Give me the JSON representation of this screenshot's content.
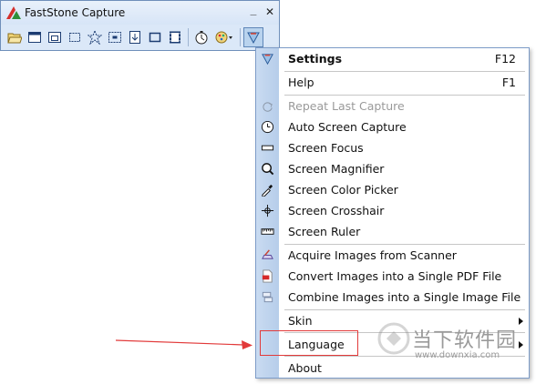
{
  "window": {
    "title": "FastStone Capture",
    "min_label": "_",
    "close_label": "✕"
  },
  "toolbar": {
    "tools": [
      {
        "name": "open-icon"
      },
      {
        "name": "capture-window-icon"
      },
      {
        "name": "capture-object-icon"
      },
      {
        "name": "capture-rectangle-icon"
      },
      {
        "name": "capture-freehand-icon"
      },
      {
        "name": "capture-fullscreen-icon"
      },
      {
        "name": "capture-scrolling-icon"
      },
      {
        "name": "capture-fixed-region-icon"
      },
      {
        "name": "video-recorder-icon"
      },
      {
        "name": "delay-timer-icon"
      },
      {
        "name": "output-destination-icon"
      },
      {
        "name": "settings-menu-icon"
      }
    ]
  },
  "menu": {
    "items": [
      {
        "label": "Settings",
        "key": "F12",
        "bold": true,
        "icon": "settings-icon"
      },
      {
        "label": "Help",
        "key": "F1",
        "icon": "help-icon"
      },
      {
        "label": "Repeat Last Capture",
        "disabled": true,
        "icon": "repeat-icon"
      },
      {
        "label": "Auto Screen Capture",
        "icon": "clock-icon"
      },
      {
        "label": "Screen Focus",
        "icon": "focus-rect-icon"
      },
      {
        "label": "Screen Magnifier",
        "icon": "magnifier-icon"
      },
      {
        "label": "Screen Color Picker",
        "icon": "eyedropper-icon"
      },
      {
        "label": "Screen Crosshair",
        "icon": "crosshair-icon"
      },
      {
        "label": "Screen Ruler",
        "icon": "ruler-icon"
      },
      {
        "label": "Acquire Images from Scanner",
        "icon": "scanner-icon"
      },
      {
        "label": "Convert Images into a Single PDF File",
        "icon": "pdf-icon"
      },
      {
        "label": "Combine Images into a Single Image File",
        "icon": "combine-images-icon"
      },
      {
        "label": "Skin",
        "submenu": true,
        "icon": ""
      },
      {
        "label": "Language",
        "submenu": true,
        "icon": ""
      },
      {
        "label": "About",
        "icon": ""
      }
    ]
  },
  "watermark": {
    "cn": "当下软件园",
    "url": "www.downxia.com"
  },
  "colors": {
    "accent_red": "#e23a3a",
    "menu_gutter": "#c2d6ef",
    "toolbar_bg": "#dbe8f8"
  }
}
